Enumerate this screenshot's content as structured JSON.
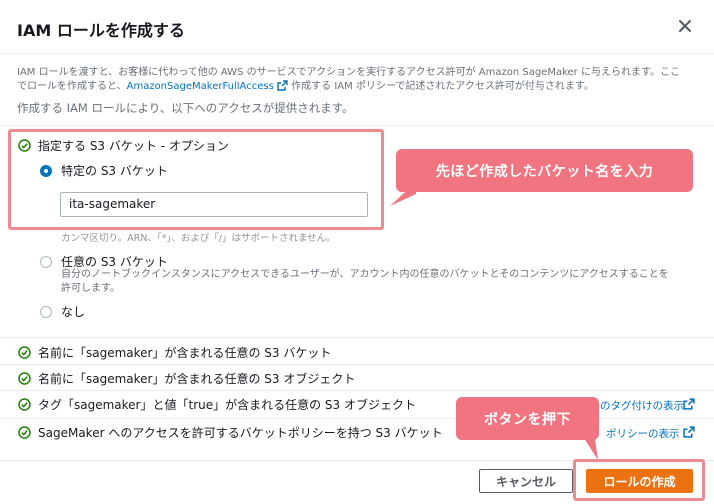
{
  "dialog": {
    "title": "IAM ロールを作成する",
    "description_line1": "IAM ロールを渡すと、お客様に代わって他の AWS のサービスでアクションを実行するアクセス許可が Amazon SageMaker に与えられます。ここ",
    "description_line2_prefix": "でロールを作成すると、",
    "description_link": "AmazonSageMakerFullAccess",
    "description_line2_suffix": " 作成する IAM ポリシーで記述されたアクセス許可が付与されます。",
    "sub_description": "作成する IAM ロールにより、以下へのアクセスが提供されます。"
  },
  "s3_option": {
    "title": "指定する S3 バケット - オプション",
    "specific_label": "特定の S3 バケット",
    "bucket_value": "ita-sagemaker",
    "hint_partial": "カンマ区切り。ARN、「*」、および「/」はサポートされません。",
    "any_label": "任意の S3 バケット",
    "any_desc_line1": "自分のノートブックインスタンスにアクセスできるユーザーが、アカウント内の任意のバケットとそのコンテンツにアクセスすることを",
    "any_desc_line2": "許可します。",
    "none_label": "なし"
  },
  "access_items": [
    "名前に「sagemaker」が含まれる任意の S3 バケット",
    "名前に「sagemaker」が含まれる任意の S3 オブジェクト",
    "タグ「sagemaker」と値「true」が含まれる任意の S3 オブジェクト",
    "SageMaker へのアクセスを許可するバケットポリシーを持つ S3 バケット"
  ],
  "links": {
    "tagging": "のタグ付けの表示",
    "policy": "ポリシーの表示"
  },
  "callouts": {
    "bucket": "先ほど作成したバケット名を入力",
    "button": "ボタンを押下"
  },
  "footer": {
    "cancel": "キャンセル",
    "create": "ロールの作成"
  },
  "colors": {
    "accent": "#ec7211",
    "link": "#0073bb",
    "check": "#1d8102",
    "highlight": "#f08a91",
    "callout": "#f07580"
  }
}
